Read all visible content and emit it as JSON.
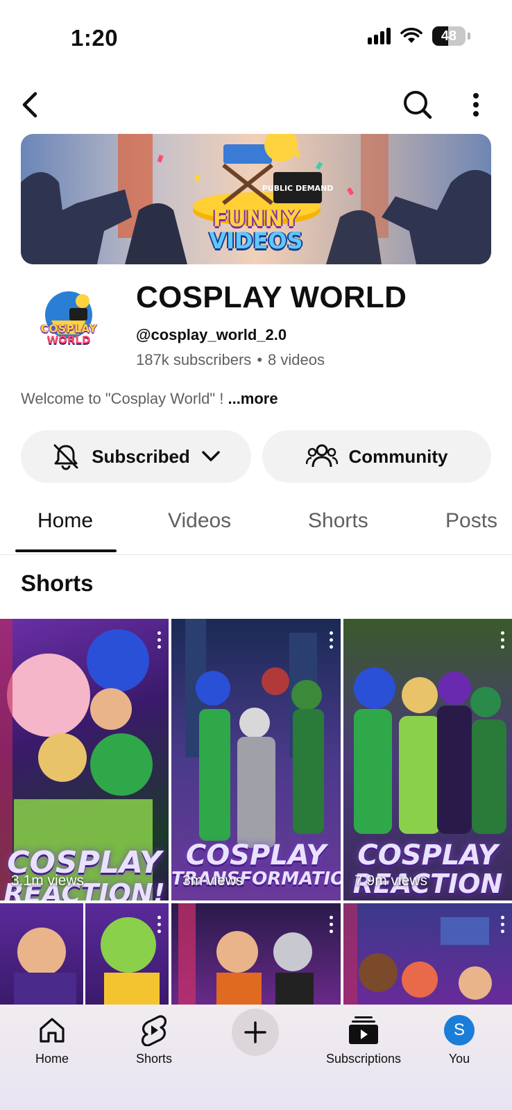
{
  "status_bar": {
    "time": "1:20",
    "battery": "48",
    "battery_level": 0.48
  },
  "top_nav": {
    "back_icon": "chevron-left-icon",
    "search_icon": "search-icon",
    "more_icon": "more-vertical-icon"
  },
  "banner": {
    "badge": "PUBLIC DEMAND",
    "title_line1": "FUNNY",
    "title_line2": "VIDEOS"
  },
  "channel": {
    "avatar_text_line1": "COSPLAY",
    "avatar_text_line2": "WORLD",
    "name": "COSPLAY WORLD",
    "handle": "@cosplay_world_2.0",
    "subscribers": "187k subscribers",
    "separator": "•",
    "video_count": "8 videos",
    "description": "Welcome to \"Cosplay World\" ! ",
    "more_label": "...more"
  },
  "actions": {
    "subscribed_label": "Subscribed",
    "community_label": "Community"
  },
  "tabs": [
    {
      "label": "Home",
      "active": true
    },
    {
      "label": "Videos",
      "active": false
    },
    {
      "label": "Shorts",
      "active": false
    },
    {
      "label": "Posts",
      "active": false
    }
  ],
  "section_title": "Shorts",
  "shorts": [
    {
      "title": "COSPLAY",
      "title2": "REACTION!",
      "views": "3.1m views"
    },
    {
      "title": "COSPLAY",
      "title2": "TRANSFORMATION!",
      "views": "3m views"
    },
    {
      "title": "COSPLAY",
      "title2": "REACTION",
      "views": "7.9m views"
    }
  ],
  "bottom_nav": {
    "home": "Home",
    "shorts": "Shorts",
    "subscriptions": "Subscriptions",
    "you": "You",
    "you_initial": "S"
  },
  "colors": {
    "accent_blue": "#1a7ed8",
    "pill_bg": "#f2f2f2",
    "muted_text": "#606060"
  }
}
